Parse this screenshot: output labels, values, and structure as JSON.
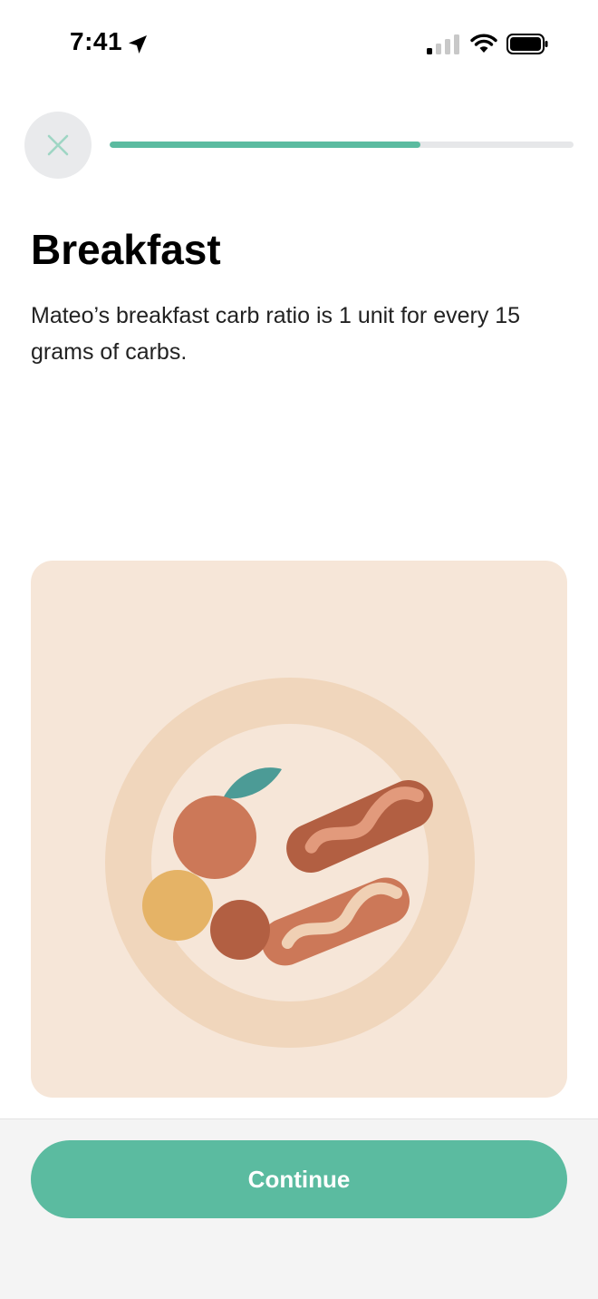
{
  "status_bar": {
    "time": "7:41",
    "location_icon": "location-arrow-icon",
    "signal_icon": "cellular-signal-icon",
    "wifi_icon": "wifi-icon",
    "battery_icon": "battery-icon"
  },
  "header": {
    "close_icon": "close-icon",
    "progress_fraction": 0.67
  },
  "content": {
    "title": "Breakfast",
    "description": "Mateo’s breakfast carb ratio is 1 unit for every 15 grams of carbs.",
    "illustration": "breakfast-plate-illustration"
  },
  "footer": {
    "continue_label": "Continue"
  },
  "colors": {
    "accent": "#5bbba0",
    "close_icon": "#9fd6c4",
    "card_background": "#f6e6d8",
    "plate_rim": "#f0d6bc",
    "orange": "#cc7858",
    "leaf": "#4c9b96",
    "sausage_dark": "#b25f42",
    "sausage_light": "#cc7858",
    "egg_yolk": "#e5b366"
  }
}
